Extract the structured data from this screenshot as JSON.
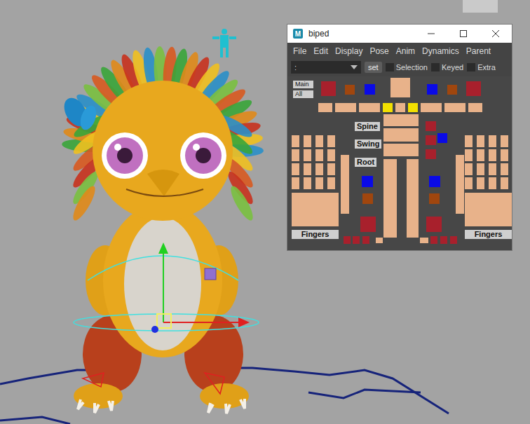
{
  "window": {
    "title": "biped",
    "icon_label": "M"
  },
  "menu": [
    "File",
    "Edit",
    "Display",
    "Pose",
    "Anim",
    "Dynamics",
    "Parent"
  ],
  "namespace": {
    "value": ":"
  },
  "set_button": "set",
  "toggles": [
    {
      "label": "Selection",
      "checked": false
    },
    {
      "label": "Keyed",
      "checked": false
    },
    {
      "label": "Extra",
      "checked": false
    }
  ],
  "labels": [
    {
      "text": "Main"
    },
    {
      "text": "All"
    },
    {
      "text": "Spine"
    },
    {
      "text": "Swing"
    },
    {
      "text": "Root"
    },
    {
      "text": "Fingers"
    },
    {
      "text": "Fingers"
    }
  ],
  "controls": [
    {
      "color": "#a8202c"
    },
    {
      "color": "#a0460e"
    },
    {
      "color": "#0a0ae6"
    },
    {
      "color": "#e8b28a"
    },
    {
      "color": "#0a0ae6"
    },
    {
      "color": "#a0460e"
    },
    {
      "color": "#a8202c"
    },
    {
      "color": "#e8b28a"
    },
    {
      "color": "#e8b28a"
    },
    {
      "color": "#e8b28a"
    },
    {
      "color": "#f2e000"
    },
    {
      "color": "#e8b28a"
    },
    {
      "color": "#f2e000"
    },
    {
      "color": "#e8b28a"
    },
    {
      "color": "#e8b28a"
    },
    {
      "color": "#e8b28a"
    },
    {
      "color": "#e8b28a"
    },
    {
      "color": "#e8b28a"
    },
    {
      "color": "#e8b28a"
    },
    {
      "color": "#a8202c"
    },
    {
      "color": "#a8202c"
    },
    {
      "color": "#0a0ae6"
    },
    {
      "color": "#a8202c"
    },
    {
      "color": "#e8b28a"
    },
    {
      "color": "#e8b28a"
    },
    {
      "color": "#0a0ae6"
    },
    {
      "color": "#0a0ae6"
    },
    {
      "color": "#a0460e"
    },
    {
      "color": "#a0460e"
    },
    {
      "color": "#a8202c"
    },
    {
      "color": "#a8202c"
    },
    {
      "color": "#e8b28a"
    },
    {
      "color": "#e8b28a"
    },
    {
      "color": "#a8202c"
    },
    {
      "color": "#a8202c"
    },
    {
      "color": "#a8202c"
    },
    {
      "color": "#a8202c"
    },
    {
      "color": "#a8202c"
    },
    {
      "color": "#a8202c"
    },
    {
      "color": "#e8b28a"
    },
    {
      "color": "#e8b28a"
    },
    {
      "color": "#e8b28a"
    },
    {
      "color": "#e8b28a"
    },
    {
      "color": "#e8b28a"
    },
    {
      "color": "#e8b28a"
    },
    {
      "color": "#e8b28a"
    },
    {
      "color": "#e8b28a"
    },
    {
      "color": "#e8b28a"
    },
    {
      "color": "#e8b28a"
    },
    {
      "color": "#e8b28a"
    },
    {
      "color": "#e8b28a"
    },
    {
      "color": "#e8b28a"
    },
    {
      "color": "#e8b28a"
    },
    {
      "color": "#e8b28a"
    },
    {
      "color": "#e8b28a"
    },
    {
      "color": "#e8b28a"
    },
    {
      "color": "#e8b28a"
    },
    {
      "color": "#e8b28a"
    },
    {
      "color": "#e8b28a"
    },
    {
      "color": "#e8b28a"
    },
    {
      "color": "#e8b28a"
    },
    {
      "color": "#e8b28a"
    },
    {
      "color": "#e8b28a"
    },
    {
      "color": "#e8b28a"
    },
    {
      "color": "#e8b28a"
    },
    {
      "color": "#e8b28a"
    },
    {
      "color": "#e8b28a"
    },
    {
      "color": "#e8b28a"
    },
    {
      "color": "#e8b28a"
    },
    {
      "color": "#e8b28a"
    },
    {
      "color": "#e8b28a"
    },
    {
      "color": "#e8b28a"
    },
    {
      "color": "#e8b28a"
    },
    {
      "color": "#e8b28a"
    },
    {
      "color": "#e8b28a"
    }
  ]
}
